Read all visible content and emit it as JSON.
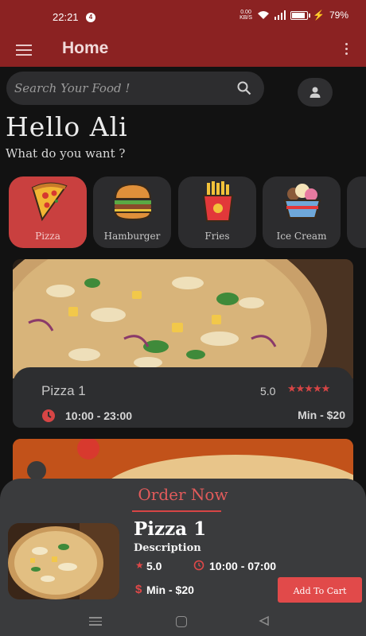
{
  "status_bar": {
    "time": "22:21",
    "notification_count": "4",
    "net_speed_top": "0.00",
    "net_speed_unit": "KB/S",
    "battery": "79%",
    "battery_level": 0.79
  },
  "app_bar": {
    "title": "Home",
    "menu_icon": "hamburger-menu-icon",
    "overflow_icon": "more-vert-icon"
  },
  "search": {
    "placeholder": "Search Your Food !"
  },
  "greeting": {
    "title": "Hello Ali",
    "subtitle": "What do you want ?"
  },
  "categories": [
    {
      "label": "Pizza",
      "icon": "pizza-icon",
      "active": true
    },
    {
      "label": "Hamburger",
      "icon": "hamburger-icon",
      "active": false
    },
    {
      "label": "Fries",
      "icon": "fries-icon",
      "active": false
    },
    {
      "label": "Ice Cream",
      "icon": "ice-cream-icon",
      "active": false
    }
  ],
  "food_card": {
    "name": "Pizza 1",
    "rating": "5.0",
    "stars": "★★★★★",
    "hours": "10:00 - 23:00",
    "min_price": "Min - $20"
  },
  "order_sheet": {
    "title": "Order Now",
    "name": "Pizza 1",
    "description": "Description",
    "rating": "5.0",
    "hours": "10:00 - 07:00",
    "currency": "$",
    "min_price": "Min - $20",
    "add_to_cart": "Add To Cart"
  },
  "colors": {
    "primary": "#8b2222",
    "accent": "#e14a4a",
    "background": "#121212",
    "surface": "#2d2e30"
  }
}
